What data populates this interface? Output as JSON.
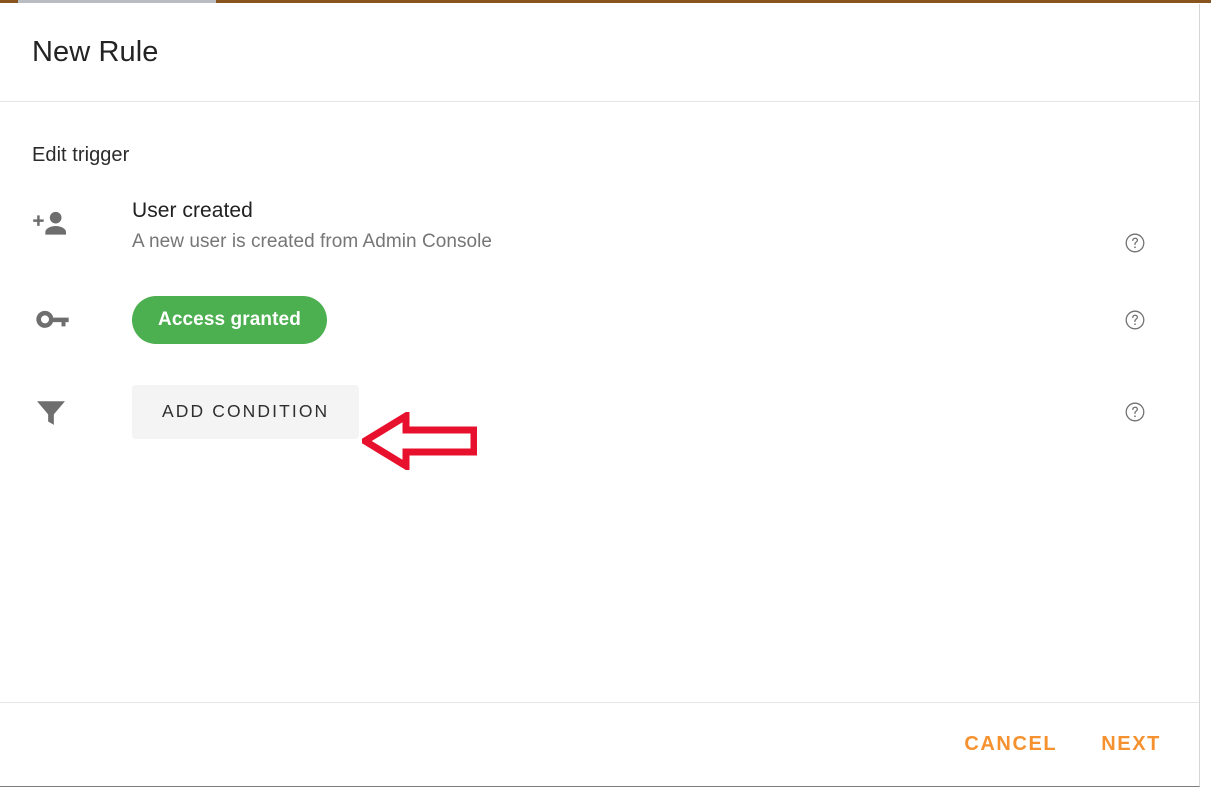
{
  "dialog": {
    "title": "New Rule",
    "section_title": "Edit trigger",
    "trigger": {
      "icon": "person-add-icon",
      "name": "User created",
      "description": "A new user is created from Admin Console",
      "help_icon": "help-circle-icon"
    },
    "outcome": {
      "icon": "key-icon",
      "chip_label": "Access granted",
      "chip_color": "#4CAF50",
      "help_icon": "help-circle-icon"
    },
    "condition": {
      "icon": "filter-funnel-icon",
      "add_label": "ADD CONDITION",
      "help_icon": "help-circle-icon"
    },
    "footer": {
      "cancel_label": "CANCEL",
      "next_label": "NEXT",
      "accent_color": "#F5922F"
    }
  },
  "annotation": {
    "arrow_icon": "left-arrow-annotation",
    "arrow_color": "#E8112D",
    "points_to": "ADD CONDITION"
  }
}
